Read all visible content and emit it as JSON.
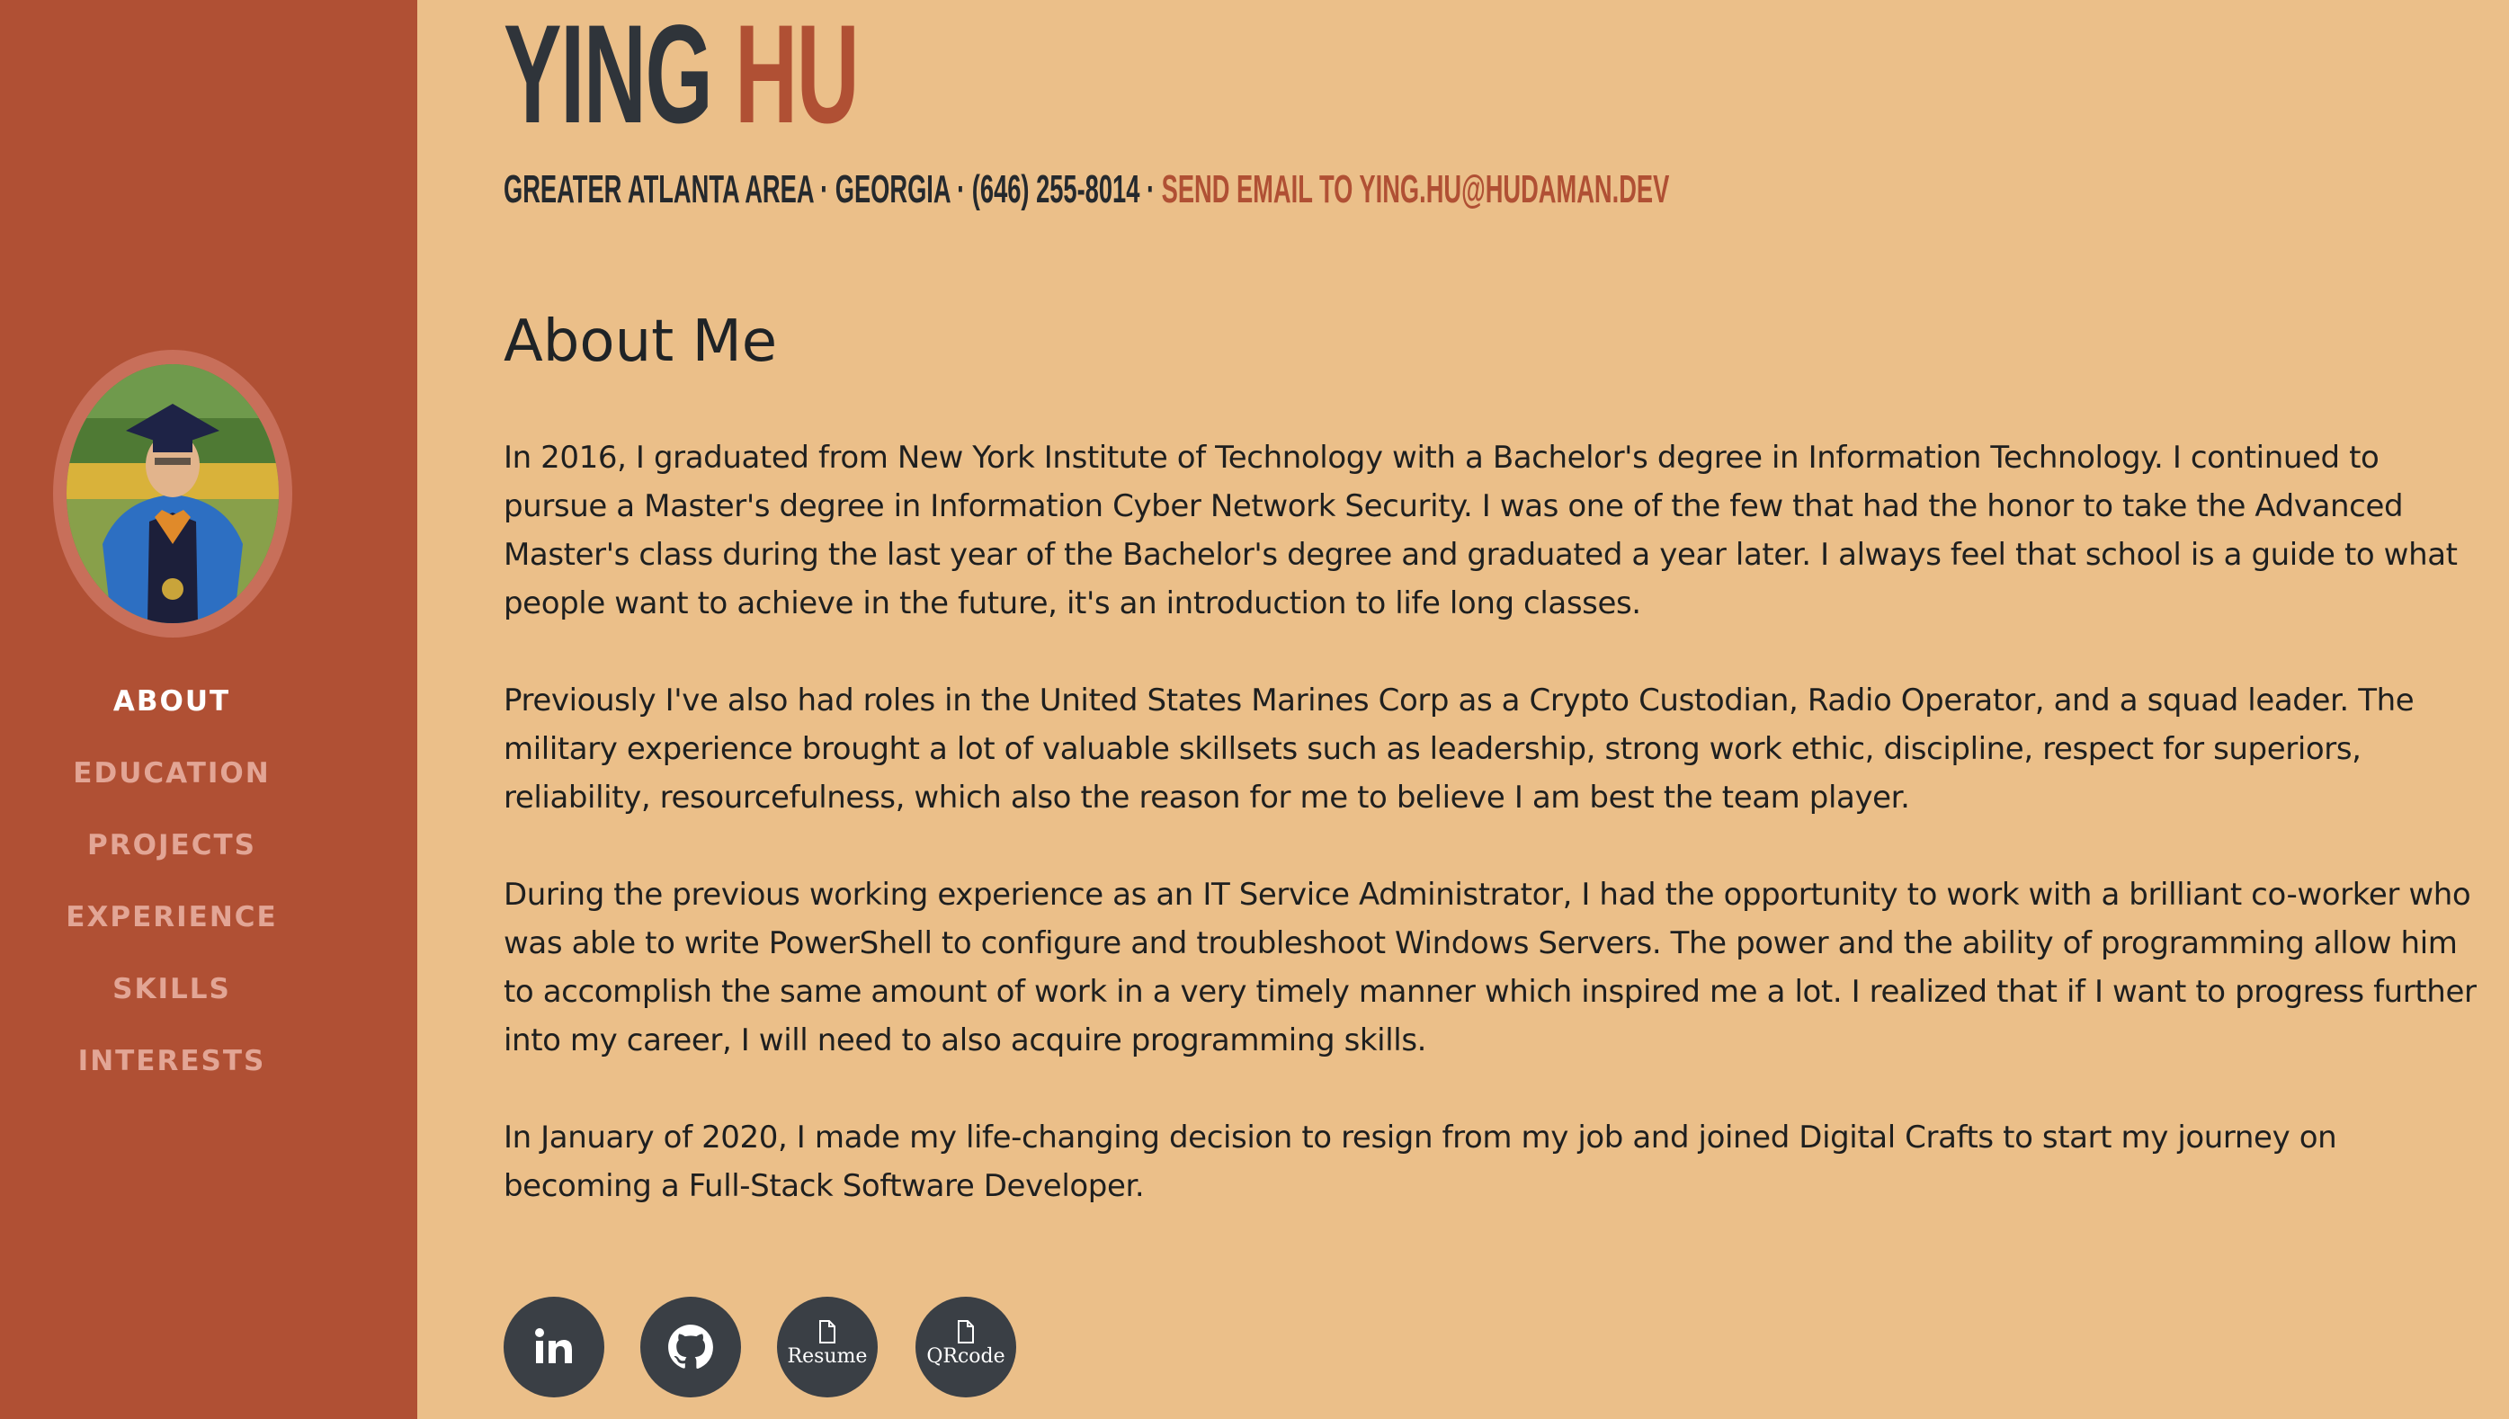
{
  "profile": {
    "first_name": "YING",
    "last_name": "HU",
    "location": "GREATER ATLANTA AREA · GEORGIA · (646) 255-8014 ·",
    "email_link": "SEND EMAIL TO YING.HU@HUDAMAN.DEV"
  },
  "nav": {
    "items": [
      {
        "label": "ABOUT",
        "active": true
      },
      {
        "label": "EDUCATION",
        "active": false
      },
      {
        "label": "PROJECTS",
        "active": false
      },
      {
        "label": "EXPERIENCE",
        "active": false
      },
      {
        "label": "SKILLS",
        "active": false
      },
      {
        "label": "INTERESTS",
        "active": false
      }
    ]
  },
  "about": {
    "title": "About Me",
    "paragraphs": [
      "In 2016, I graduated from New York Institute of Technology with a Bachelor's degree in Information Technology. I continued to pursue a Master's degree in Information Cyber Network Security. I was one of the few that had the honor to take the Advanced Master's class during the last year of the Bachelor's degree and graduated a year later. I always feel that school is a guide to what people want to achieve in the future, it's an introduction to life long classes.",
      "Previously I've also had roles in the United States Marines Corp as a Crypto Custodian, Radio Operator, and a squad leader. The military experience brought a lot of valuable skillsets such as leadership, strong work ethic, discipline, respect for superiors, reliability, resourcefulness, which also the reason for me to believe I am best the team player.",
      "During the previous working experience as an IT Service Administrator, I had the opportunity to work with a brilliant co-worker who was able to write PowerShell to configure and troubleshoot Windows Servers. The power and the ability of programming allow him to accomplish the same amount of work in a very timely manner which inspired me a lot. I realized that if I want to progress further into my career, I will need to also acquire programming skills.",
      "In January of 2020, I made my life-changing decision to resign from my job and joined Digital Crafts to start my journey on becoming a Full-Stack Software Developer."
    ]
  },
  "social": {
    "linkedin_icon": "linkedin-icon",
    "github_icon": "github-icon",
    "resume_label": "Resume",
    "qrcode_label": "QRcode"
  },
  "colors": {
    "sidebar": "#b05034",
    "background": "#ebbf89",
    "accent": "#b05034",
    "dark": "#2f343a"
  }
}
